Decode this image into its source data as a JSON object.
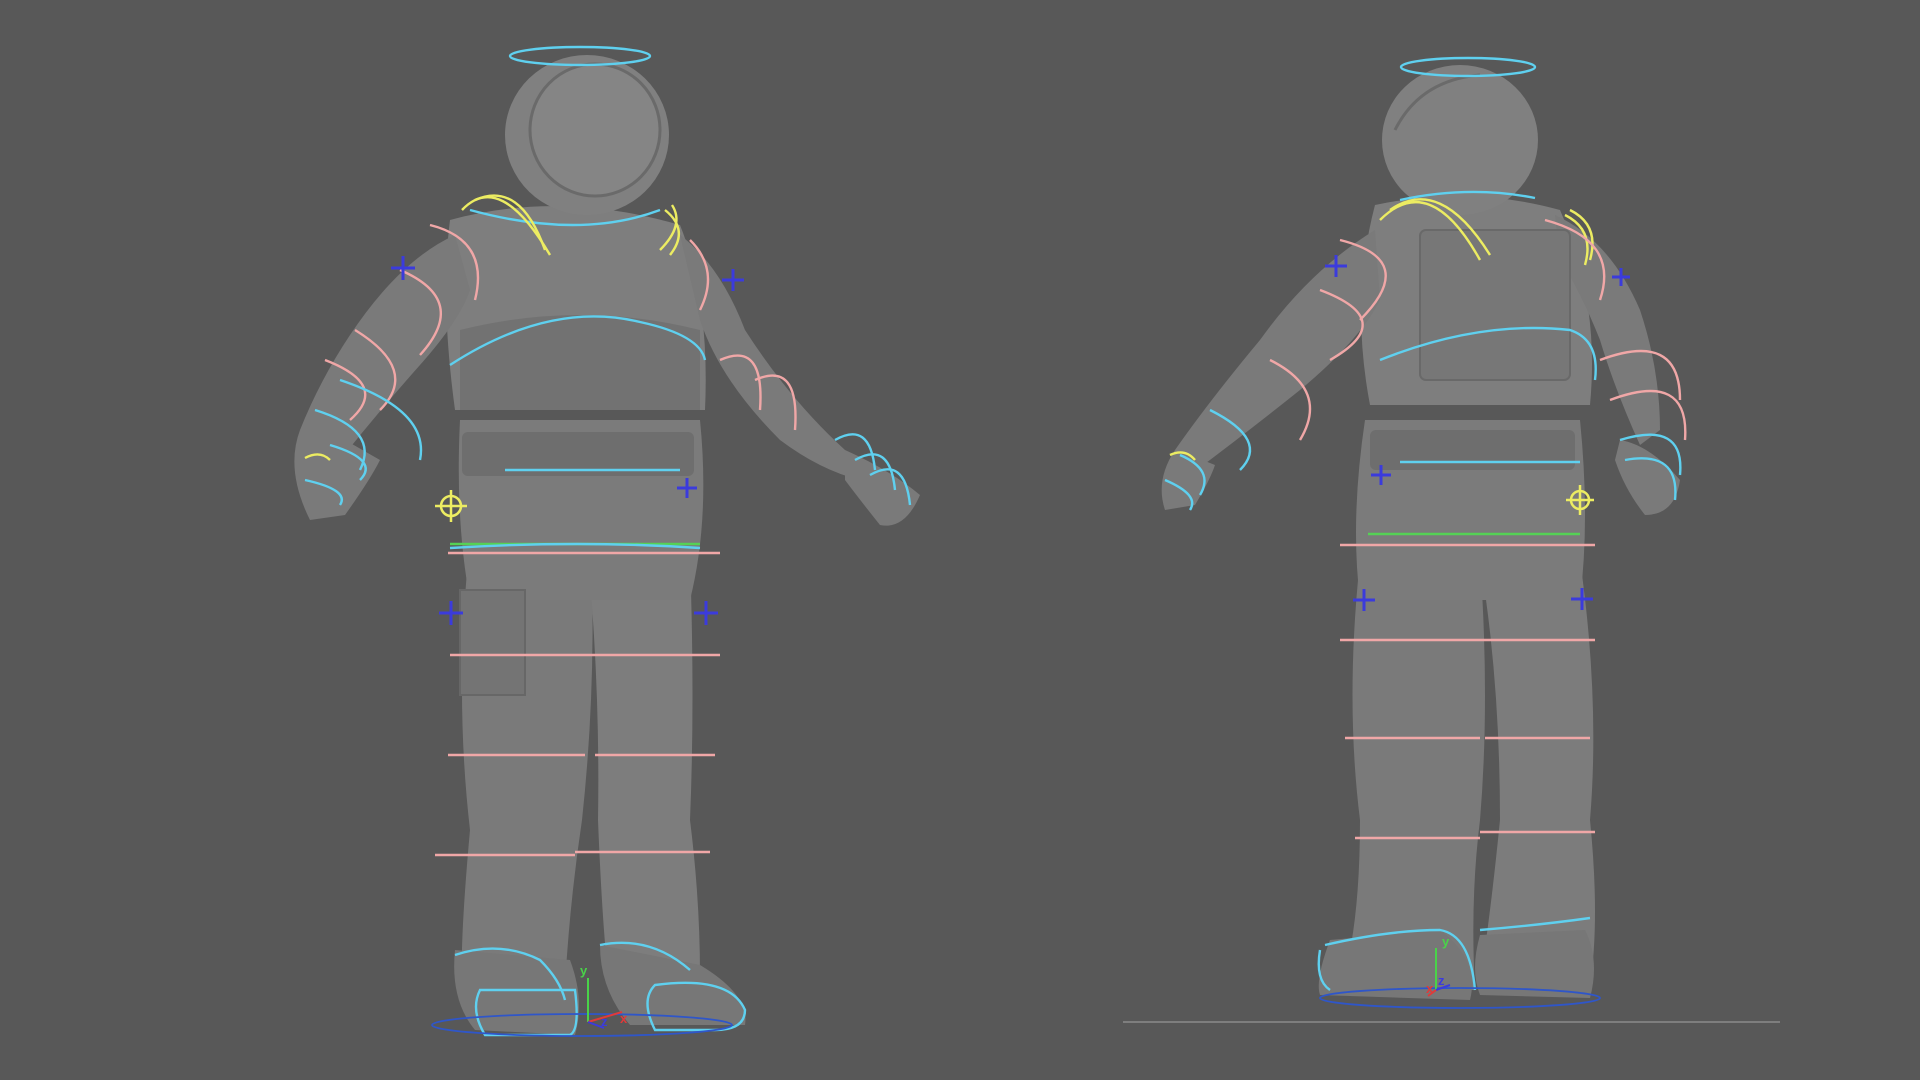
{
  "viewport": {
    "background": "#585858",
    "views": [
      "front-three-quarter",
      "back-three-quarter"
    ]
  },
  "colors": {
    "body": "#7c7c7c",
    "body_shadow": "#6b6b6b",
    "body_dark": "#5e5e5e",
    "fk_control": "#5fd0ef",
    "ik_control": "#f0a7a7",
    "clavicle_control": "#ecec62",
    "hip_control": "#55d155",
    "locator": "#3b3bdc",
    "ground": "#2f56c9",
    "ground_line": "#8a8a8a"
  },
  "gizmo": {
    "y_label": "y",
    "z_label": "z",
    "x_label": "x",
    "y_color": "#49d349",
    "z_color": "#3b3bdc",
    "x_color": "#e03a3a"
  },
  "icons": [
    "pole-vector-locator-icon",
    "pivot-control-icon",
    "axis-gizmo-icon",
    "halo-control-icon"
  ]
}
